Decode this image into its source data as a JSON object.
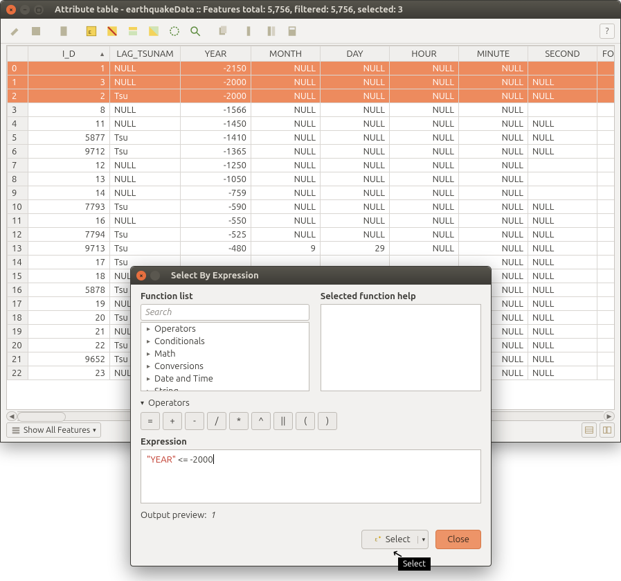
{
  "window": {
    "title": "Attribute table - earthquakeData :: Features total: 5,756, filtered: 5,756, selected: 3"
  },
  "columns": [
    "I_D",
    "LAG_TSUNAM",
    "YEAR",
    "MONTH",
    "DAY",
    "HOUR",
    "MINUTE",
    "SECOND",
    "FOC"
  ],
  "rows": [
    {
      "n": "0",
      "sel": true,
      "id": "1",
      "lag": "NULL",
      "year": "-2150",
      "month": "NULL",
      "day": "NULL",
      "hour": "NULL",
      "min": "NULL",
      "sec": ""
    },
    {
      "n": "1",
      "sel": true,
      "id": "3",
      "lag": "NULL",
      "year": "-2000",
      "month": "NULL",
      "day": "NULL",
      "hour": "NULL",
      "min": "NULL",
      "sec": "NULL"
    },
    {
      "n": "2",
      "sel": true,
      "id": "2",
      "lag": "Tsu",
      "year": "-2000",
      "month": "NULL",
      "day": "NULL",
      "hour": "NULL",
      "min": "NULL",
      "sec": "NULL"
    },
    {
      "n": "3",
      "sel": false,
      "id": "8",
      "lag": "NULL",
      "year": "-1566",
      "month": "NULL",
      "day": "NULL",
      "hour": "NULL",
      "min": "NULL",
      "sec": ""
    },
    {
      "n": "4",
      "sel": false,
      "id": "11",
      "lag": "NULL",
      "year": "-1450",
      "month": "NULL",
      "day": "NULL",
      "hour": "NULL",
      "min": "NULL",
      "sec": "NULL"
    },
    {
      "n": "5",
      "sel": false,
      "id": "5877",
      "lag": "Tsu",
      "year": "-1410",
      "month": "NULL",
      "day": "NULL",
      "hour": "NULL",
      "min": "NULL",
      "sec": "NULL"
    },
    {
      "n": "6",
      "sel": false,
      "id": "9712",
      "lag": "Tsu",
      "year": "-1365",
      "month": "NULL",
      "day": "NULL",
      "hour": "NULL",
      "min": "NULL",
      "sec": "NULL"
    },
    {
      "n": "7",
      "sel": false,
      "id": "12",
      "lag": "NULL",
      "year": "-1250",
      "month": "NULL",
      "day": "NULL",
      "hour": "NULL",
      "min": "NULL",
      "sec": ""
    },
    {
      "n": "8",
      "sel": false,
      "id": "13",
      "lag": "NULL",
      "year": "-1050",
      "month": "NULL",
      "day": "NULL",
      "hour": "NULL",
      "min": "NULL",
      "sec": ""
    },
    {
      "n": "9",
      "sel": false,
      "id": "14",
      "lag": "NULL",
      "year": "-759",
      "month": "NULL",
      "day": "NULL",
      "hour": "NULL",
      "min": "NULL",
      "sec": ""
    },
    {
      "n": "10",
      "sel": false,
      "id": "7793",
      "lag": "Tsu",
      "year": "-590",
      "month": "NULL",
      "day": "NULL",
      "hour": "NULL",
      "min": "NULL",
      "sec": "NULL"
    },
    {
      "n": "11",
      "sel": false,
      "id": "16",
      "lag": "NULL",
      "year": "-550",
      "month": "NULL",
      "day": "NULL",
      "hour": "NULL",
      "min": "NULL",
      "sec": "NULL"
    },
    {
      "n": "12",
      "sel": false,
      "id": "7794",
      "lag": "Tsu",
      "year": "-525",
      "month": "NULL",
      "day": "NULL",
      "hour": "NULL",
      "min": "NULL",
      "sec": "NULL"
    },
    {
      "n": "13",
      "sel": false,
      "id": "9713",
      "lag": "Tsu",
      "year": "-480",
      "month": "9",
      "day": "29",
      "hour": "NULL",
      "min": "NULL",
      "sec": "NULL"
    },
    {
      "n": "14",
      "sel": false,
      "id": "17",
      "lag": "Tsu",
      "year": "",
      "month": "",
      "day": "",
      "hour": "",
      "min": "NULL",
      "sec": "NULL"
    },
    {
      "n": "15",
      "sel": false,
      "id": "18",
      "lag": "NUL",
      "year": "",
      "month": "",
      "day": "",
      "hour": "",
      "min": "NULL",
      "sec": "NULL"
    },
    {
      "n": "16",
      "sel": false,
      "id": "5878",
      "lag": "Tsu",
      "year": "",
      "month": "",
      "day": "",
      "hour": "",
      "min": "NULL",
      "sec": "NULL"
    },
    {
      "n": "17",
      "sel": false,
      "id": "19",
      "lag": "NUL",
      "year": "",
      "month": "",
      "day": "",
      "hour": "",
      "min": "NULL",
      "sec": "NULL"
    },
    {
      "n": "18",
      "sel": false,
      "id": "20",
      "lag": "Tsu",
      "year": "",
      "month": "",
      "day": "",
      "hour": "",
      "min": "NULL",
      "sec": "NULL"
    },
    {
      "n": "19",
      "sel": false,
      "id": "21",
      "lag": "NUL",
      "year": "",
      "month": "",
      "day": "",
      "hour": "",
      "min": "NULL",
      "sec": "NULL"
    },
    {
      "n": "20",
      "sel": false,
      "id": "22",
      "lag": "Tsu",
      "year": "",
      "month": "",
      "day": "",
      "hour": "",
      "min": "NULL",
      "sec": "NULL"
    },
    {
      "n": "21",
      "sel": false,
      "id": "9652",
      "lag": "Tsu",
      "year": "",
      "month": "",
      "day": "",
      "hour": "",
      "min": "NULL",
      "sec": "NULL"
    },
    {
      "n": "22",
      "sel": false,
      "id": "23",
      "lag": "NUL",
      "year": "",
      "month": "",
      "day": "",
      "hour": "",
      "min": "NULL",
      "sec": "NULL"
    }
  ],
  "footer": {
    "show_all": "Show All Features"
  },
  "dialog": {
    "title": "Select By Expression",
    "func_list_label": "Function list",
    "help_label": "Selected function help",
    "search_placeholder": "Search",
    "categories": [
      "Operators",
      "Conditionals",
      "Math",
      "Conversions",
      "Date and Time",
      "String"
    ],
    "ops_header": "Operators",
    "ops": [
      "=",
      "+",
      "-",
      "/",
      "*",
      "^",
      "||",
      "(",
      ")"
    ],
    "expr_label": "Expression",
    "expr_field": "\"YEAR\"",
    "expr_rest": " <= -2000",
    "preview_label": "Output preview:",
    "preview_value": "1",
    "select_btn": "Select",
    "close_btn": "Close"
  },
  "tooltip": "Select"
}
